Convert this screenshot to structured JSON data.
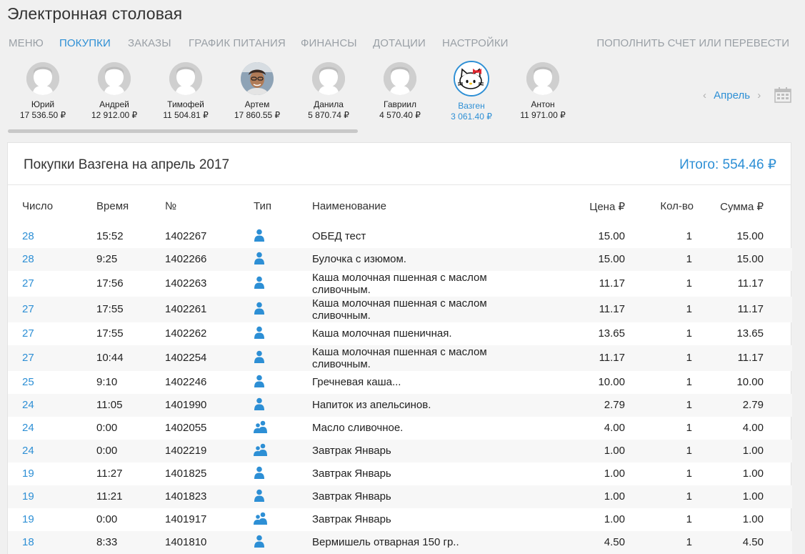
{
  "app": {
    "title": "Электронная столовая"
  },
  "nav": {
    "items": [
      {
        "label": "МЕНЮ",
        "active": false
      },
      {
        "label": "ПОКУПКИ",
        "active": true
      },
      {
        "label": "ЗАКАЗЫ",
        "active": false
      },
      {
        "label": "ГРАФИК ПИТАНИЯ",
        "active": false
      },
      {
        "label": "ФИНАНСЫ",
        "active": false
      },
      {
        "label": "ДОТАЦИИ",
        "active": false
      },
      {
        "label": "НАСТРОЙКИ",
        "active": false
      }
    ],
    "right_label": "ПОПОЛНИТЬ СЧЕТ ИЛИ ПЕРЕВЕСТИ"
  },
  "people": [
    {
      "name": "Юрий",
      "balance": "17 536.50 ₽",
      "avatar": "default-avatar-icon"
    },
    {
      "name": "Андрей",
      "balance": "12 912.00 ₽",
      "avatar": "default-avatar-icon"
    },
    {
      "name": "Тимофей",
      "balance": "11 504.81 ₽",
      "avatar": "default-avatar-icon"
    },
    {
      "name": "Артем",
      "balance": "17 860.55 ₽",
      "avatar": "photo-avatar"
    },
    {
      "name": "Данила",
      "balance": "5 870.74 ₽",
      "avatar": "default-avatar-icon"
    },
    {
      "name": "Гавриил",
      "balance": "4 570.40 ₽",
      "avatar": "default-avatar-icon"
    },
    {
      "name": "Вазген",
      "balance": "3 061.40 ₽",
      "avatar": "hello-kitty-avatar",
      "selected": true
    },
    {
      "name": "Антон",
      "balance": "11 971.00 ₽",
      "avatar": "default-avatar-icon"
    }
  ],
  "month_nav": {
    "prev": "‹",
    "month": "Апрель",
    "next": "›"
  },
  "panel": {
    "title": "Покупки Вазгена на апрель 2017",
    "total": "Итого: 554.46 ₽"
  },
  "table": {
    "headers": {
      "day": "Число",
      "time": "Время",
      "num": "№",
      "type": "Тип",
      "name": "Наименование",
      "price": "Цена ₽",
      "qty": "Кол-во",
      "sum": "Сумма ₽"
    },
    "rows": [
      {
        "day": "28",
        "time": "15:52",
        "num": "1402267",
        "type": "single",
        "name": "ОБЕД тест",
        "price": "15.00",
        "qty": "1",
        "sum": "15.00"
      },
      {
        "day": "28",
        "time": "9:25",
        "num": "1402266",
        "type": "single",
        "name": "Булочка с изюмом.",
        "price": "15.00",
        "qty": "1",
        "sum": "15.00"
      },
      {
        "day": "27",
        "time": "17:56",
        "num": "1402263",
        "type": "single",
        "name": "Каша молочная пшенная с маслом сливочным.",
        "price": "11.17",
        "qty": "1",
        "sum": "11.17"
      },
      {
        "day": "27",
        "time": "17:55",
        "num": "1402261",
        "type": "single",
        "name": "Каша молочная пшенная с маслом сливочным.",
        "price": "11.17",
        "qty": "1",
        "sum": "11.17"
      },
      {
        "day": "27",
        "time": "17:55",
        "num": "1402262",
        "type": "single",
        "name": "Каша молочная пшеничная.",
        "price": "13.65",
        "qty": "1",
        "sum": "13.65"
      },
      {
        "day": "27",
        "time": "10:44",
        "num": "1402254",
        "type": "single",
        "name": "Каша молочная пшенная с маслом сливочным.",
        "price": "11.17",
        "qty": "1",
        "sum": "11.17"
      },
      {
        "day": "25",
        "time": "9:10",
        "num": "1402246",
        "type": "single",
        "name": "Гречневая каша...",
        "price": "10.00",
        "qty": "1",
        "sum": "10.00"
      },
      {
        "day": "24",
        "time": "11:05",
        "num": "1401990",
        "type": "single",
        "name": "Напиток из апельсинов.",
        "price": "2.79",
        "qty": "1",
        "sum": "2.79"
      },
      {
        "day": "24",
        "time": "0:00",
        "num": "1402055",
        "type": "group",
        "name": "Масло сливочное.",
        "price": "4.00",
        "qty": "1",
        "sum": "4.00"
      },
      {
        "day": "24",
        "time": "0:00",
        "num": "1402219",
        "type": "group",
        "name": "Завтрак Январь",
        "price": "1.00",
        "qty": "1",
        "sum": "1.00"
      },
      {
        "day": "19",
        "time": "11:27",
        "num": "1401825",
        "type": "single",
        "name": "Завтрак Январь",
        "price": "1.00",
        "qty": "1",
        "sum": "1.00"
      },
      {
        "day": "19",
        "time": "11:21",
        "num": "1401823",
        "type": "single",
        "name": "Завтрак Январь",
        "price": "1.00",
        "qty": "1",
        "sum": "1.00"
      },
      {
        "day": "19",
        "time": "0:00",
        "num": "1401917",
        "type": "group",
        "name": "Завтрак Январь",
        "price": "1.00",
        "qty": "1",
        "sum": "1.00"
      },
      {
        "day": "18",
        "time": "8:33",
        "num": "1401810",
        "type": "single",
        "name": "Вермишель отварная 150 гр..",
        "price": "4.50",
        "qty": "1",
        "sum": "4.50"
      }
    ]
  },
  "colors": {
    "accent": "#2d8fd5",
    "nav_inactive": "#9aa0a6",
    "text": "#222222"
  }
}
